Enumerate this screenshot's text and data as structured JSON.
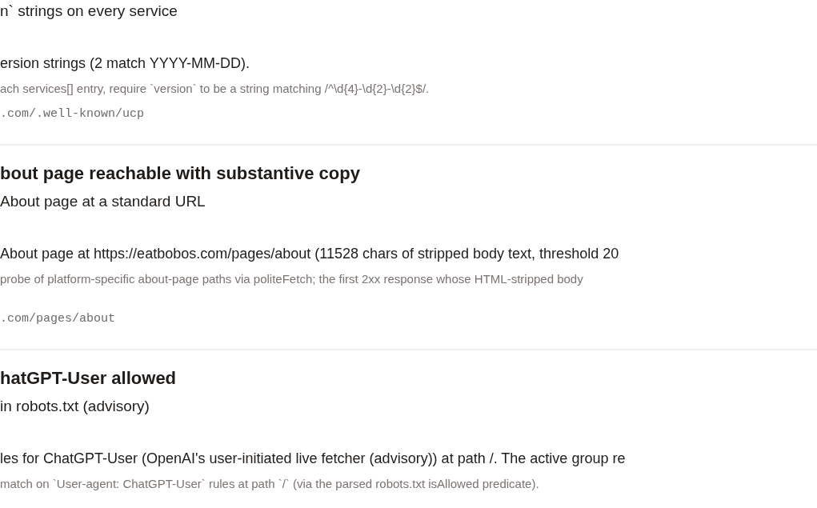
{
  "checks": [
    {
      "subtitle": "n` strings on every service",
      "result": "ersion strings (2 match YYYY-MM-DD).",
      "detail": "ach services[] entry, require `version` to be a string matching /^\\d{4}-\\d{2}-\\d{2}$/.",
      "url": ".com/.well-known/ucp"
    },
    {
      "title": "bout page reachable with substantive copy",
      "subtitle": "About page at a standard URL",
      "result": "About page at https://eatbobos.com/pages/about (11528 chars of stripped body text, threshold 20",
      "detail": "probe of platform-specific about-page paths via politeFetch; the first 2xx response whose HTML-stripped body",
      "url": ".com/pages/about"
    },
    {
      "title": "hatGPT-User allowed",
      "subtitle": "in robots.txt (advisory)",
      "result": "les for ChatGPT-User (OpenAI's user-initiated live fetcher (advisory)) at path /. The active group re",
      "detail": "match on `User-agent: ChatGPT-User` rules at path `/` (via the parsed robots.txt isAllowed predicate)."
    }
  ]
}
